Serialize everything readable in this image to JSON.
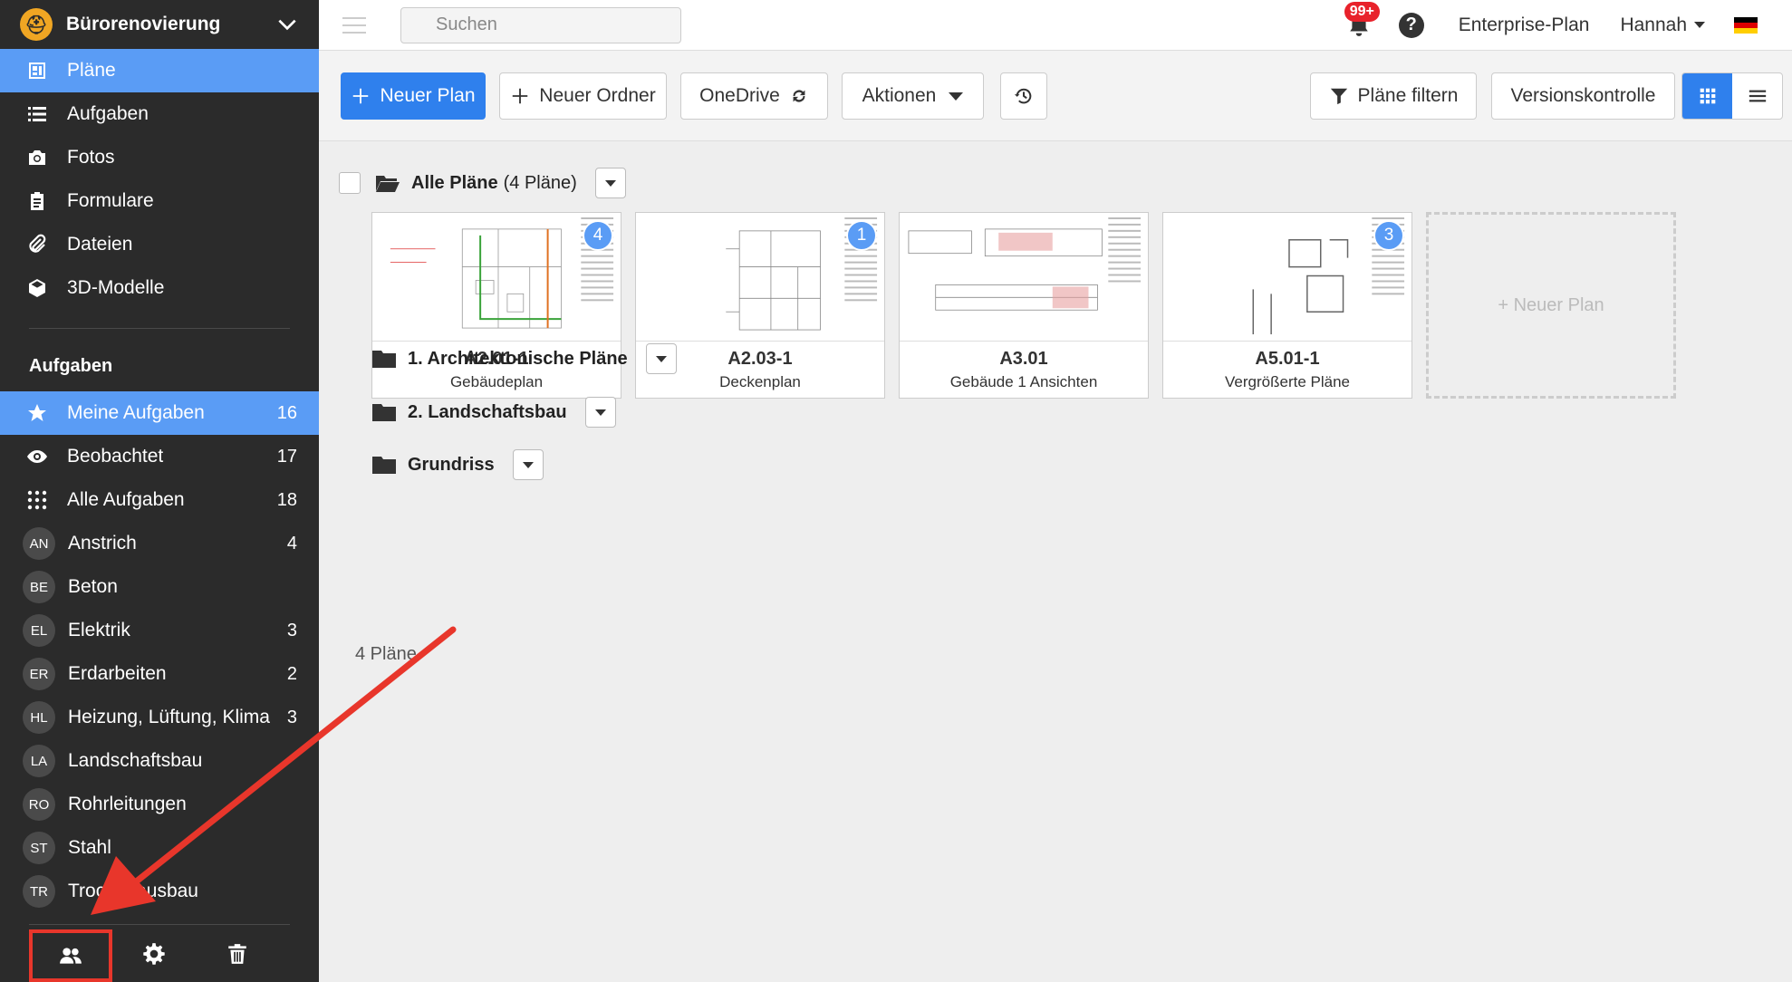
{
  "sidebar": {
    "project": "Bürorenovierung",
    "nav": [
      {
        "label": "Pläne",
        "icon": "plans-icon"
      },
      {
        "label": "Aufgaben",
        "icon": "list-icon"
      },
      {
        "label": "Fotos",
        "icon": "camera-icon"
      },
      {
        "label": "Formulare",
        "icon": "clipboard-icon"
      },
      {
        "label": "Dateien",
        "icon": "paperclip-icon"
      },
      {
        "label": "3D-Modelle",
        "icon": "cube-icon"
      }
    ],
    "tasks_title": "Aufgaben",
    "tasks": [
      {
        "label": "Meine Aufgaben",
        "count": "16"
      },
      {
        "label": "Beobachtet",
        "count": "17"
      },
      {
        "label": "Alle Aufgaben",
        "count": "18"
      }
    ],
    "trades": [
      {
        "abbr": "AN",
        "label": "Anstrich",
        "count": "4"
      },
      {
        "abbr": "BE",
        "label": "Beton",
        "count": ""
      },
      {
        "abbr": "EL",
        "label": "Elektrik",
        "count": "3"
      },
      {
        "abbr": "ER",
        "label": "Erdarbeiten",
        "count": "2"
      },
      {
        "abbr": "HL",
        "label": "Heizung, Lüftung, Klima",
        "count": "3"
      },
      {
        "abbr": "LA",
        "label": "Landschaftsbau",
        "count": ""
      },
      {
        "abbr": "RO",
        "label": "Rohrleitungen",
        "count": ""
      },
      {
        "abbr": "ST",
        "label": "Stahl",
        "count": ""
      },
      {
        "abbr": "TR",
        "label": "Trockenausbau",
        "count": ""
      }
    ]
  },
  "topbar": {
    "search_placeholder": "Suchen",
    "notifications": "99+",
    "help": "?",
    "plan": "Enterprise-Plan",
    "user": "Hannah"
  },
  "toolbar": {
    "new_plan": "Neuer Plan",
    "new_folder": "Neuer Ordner",
    "onedrive": "OneDrive",
    "actions": "Aktionen",
    "filter": "Pläne filtern",
    "versions": "Versionskontrolle"
  },
  "content": {
    "all_title": "Alle Pläne",
    "all_count": "(4 Pläne)",
    "plans": [
      {
        "name": "A2.01-1",
        "sub": "Gebäudeplan",
        "badge": "4"
      },
      {
        "name": "A2.03-1",
        "sub": "Deckenplan",
        "badge": "1"
      },
      {
        "name": "A3.01",
        "sub": "Gebäude 1 Ansichten",
        "badge": ""
      },
      {
        "name": "A5.01-1",
        "sub": "Vergrößerte Pläne",
        "badge": "3"
      }
    ],
    "new_plan_card": "+ Neuer Plan",
    "folders": [
      "1. Architektonische Pläne",
      "2. Landschaftsbau",
      "Grundriss"
    ],
    "total": "4 Pläne"
  },
  "colors": {
    "accent": "#2f80ed",
    "sidebar_active": "#5a9cf5",
    "sidebar_bg": "#2b2b2b",
    "annotation": "#e8362b"
  }
}
